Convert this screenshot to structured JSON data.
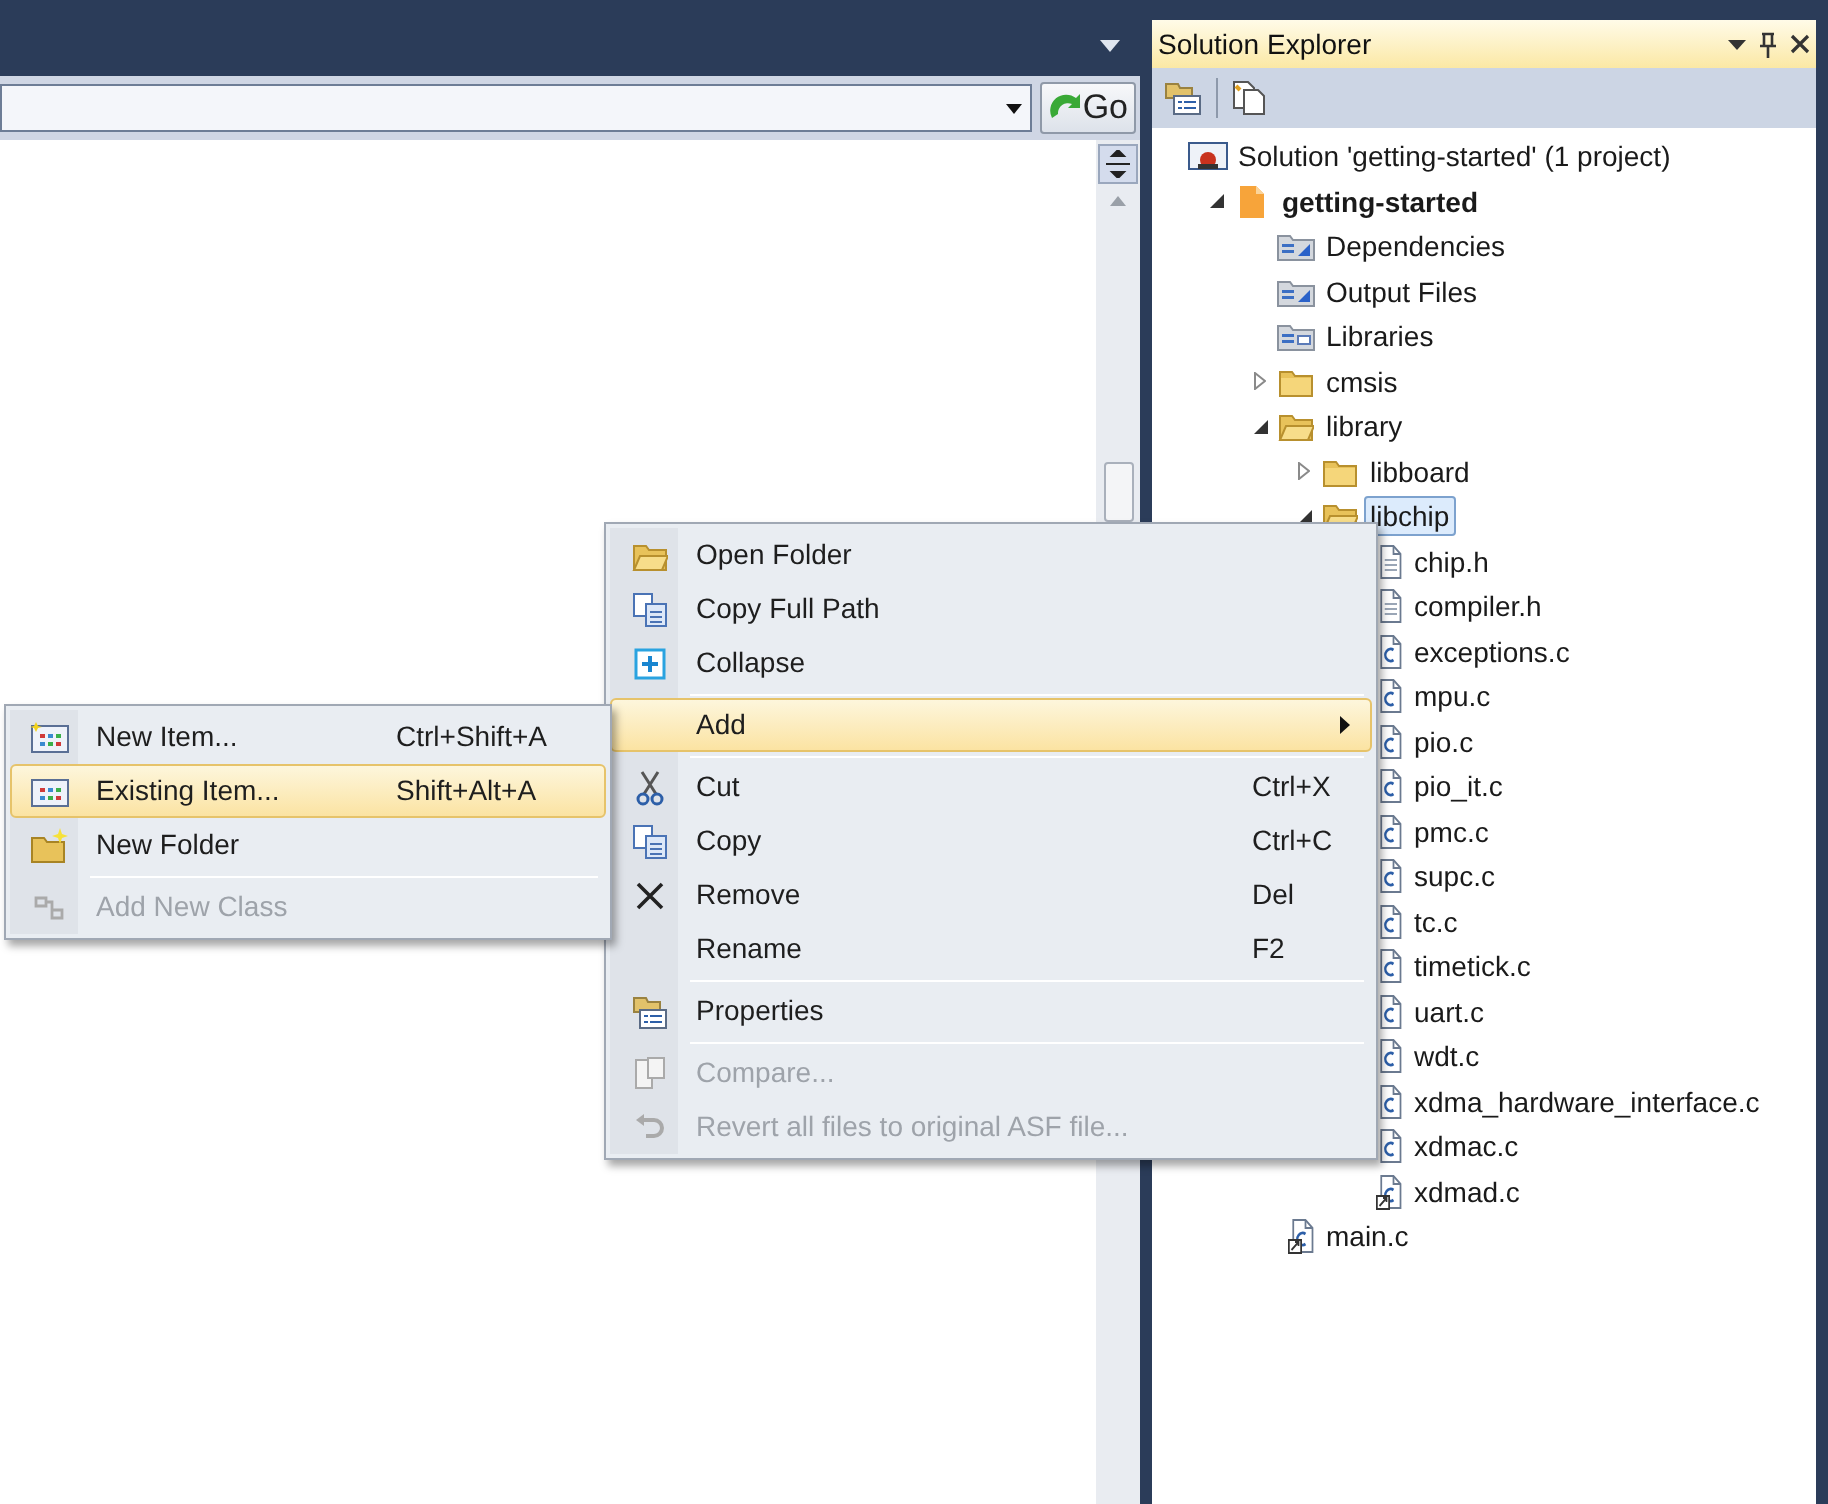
{
  "editor": {
    "go_button": "Go"
  },
  "solution_explorer": {
    "title": "Solution Explorer",
    "tree": [
      {
        "label": "Solution 'getting-started' (1 project)",
        "kind": "solution",
        "selected": false,
        "children": [
          {
            "label": "getting-started",
            "kind": "project",
            "bold": true,
            "expanded": true,
            "selected": false,
            "children": [
              {
                "label": "Dependencies",
                "kind": "reference",
                "selected": false
              },
              {
                "label": "Output Files",
                "kind": "reference",
                "selected": false
              },
              {
                "label": "Libraries",
                "kind": "library",
                "selected": false
              },
              {
                "label": "cmsis",
                "kind": "folder",
                "expanded": false,
                "selected": false
              },
              {
                "label": "library",
                "kind": "folder",
                "expanded": true,
                "selected": false,
                "children": [
                  {
                    "label": "libboard",
                    "kind": "folder",
                    "expanded": false,
                    "selected": false
                  },
                  {
                    "label": "libchip",
                    "kind": "folder",
                    "expanded": true,
                    "selected": true,
                    "children": [
                      {
                        "label": "chip.h",
                        "kind": "header",
                        "selected": false
                      },
                      {
                        "label": "compiler.h",
                        "kind": "header",
                        "selected": false
                      },
                      {
                        "label": "exceptions.c",
                        "kind": "source",
                        "selected": false
                      },
                      {
                        "label": "mpu.c",
                        "kind": "source",
                        "selected": false
                      },
                      {
                        "label": "pio.c",
                        "kind": "source",
                        "selected": false
                      },
                      {
                        "label": "pio_it.c",
                        "kind": "source",
                        "selected": false
                      },
                      {
                        "label": "pmc.c",
                        "kind": "source",
                        "selected": false
                      },
                      {
                        "label": "supc.c",
                        "kind": "source",
                        "selected": false
                      },
                      {
                        "label": "tc.c",
                        "kind": "source",
                        "selected": false
                      },
                      {
                        "label": "timetick.c",
                        "kind": "source",
                        "selected": false
                      },
                      {
                        "label": "uart.c",
                        "kind": "source",
                        "selected": false
                      },
                      {
                        "label": "wdt.c",
                        "kind": "source",
                        "selected": false
                      },
                      {
                        "label": "xdma_hardware_interface.c",
                        "kind": "source",
                        "selected": false
                      },
                      {
                        "label": "xdmac.c",
                        "kind": "source",
                        "selected": false
                      },
                      {
                        "label": "xdmad.c",
                        "kind": "link",
                        "selected": false
                      }
                    ]
                  }
                ]
              },
              {
                "label": "main.c",
                "kind": "link",
                "selected": false
              }
            ]
          }
        ]
      }
    ]
  },
  "context_menu": {
    "groups": [
      [
        {
          "label": "Open Folder",
          "disabled": false,
          "selected": false
        },
        {
          "label": "Copy Full Path",
          "disabled": false,
          "selected": false
        },
        {
          "label": "Collapse",
          "disabled": false,
          "selected": false
        }
      ],
      [
        {
          "label": "Add",
          "disabled": false,
          "selected": true,
          "submenu": true
        }
      ],
      [
        {
          "label": "Cut",
          "shortcut": "Ctrl+X",
          "disabled": false,
          "selected": false
        },
        {
          "label": "Copy",
          "shortcut": "Ctrl+C",
          "disabled": false,
          "selected": false
        },
        {
          "label": "Remove",
          "shortcut": "Del",
          "disabled": false,
          "selected": false
        },
        {
          "label": "Rename",
          "shortcut": "F2",
          "disabled": false,
          "selected": false
        }
      ],
      [
        {
          "label": "Properties",
          "disabled": false,
          "selected": false
        }
      ],
      [
        {
          "label": "Compare...",
          "disabled": true,
          "selected": false
        },
        {
          "label": "Revert all files to original ASF file...",
          "disabled": true,
          "selected": false
        }
      ]
    ]
  },
  "submenu": {
    "groups": [
      [
        {
          "label": "New Item...",
          "shortcut": "Ctrl+Shift+A",
          "disabled": false,
          "selected": false
        },
        {
          "label": "Existing Item...",
          "shortcut": "Shift+Alt+A",
          "disabled": false,
          "selected": true
        },
        {
          "label": "New Folder",
          "disabled": false,
          "selected": false
        }
      ],
      [
        {
          "label": "Add New Class",
          "disabled": true,
          "selected": false
        }
      ]
    ]
  }
}
